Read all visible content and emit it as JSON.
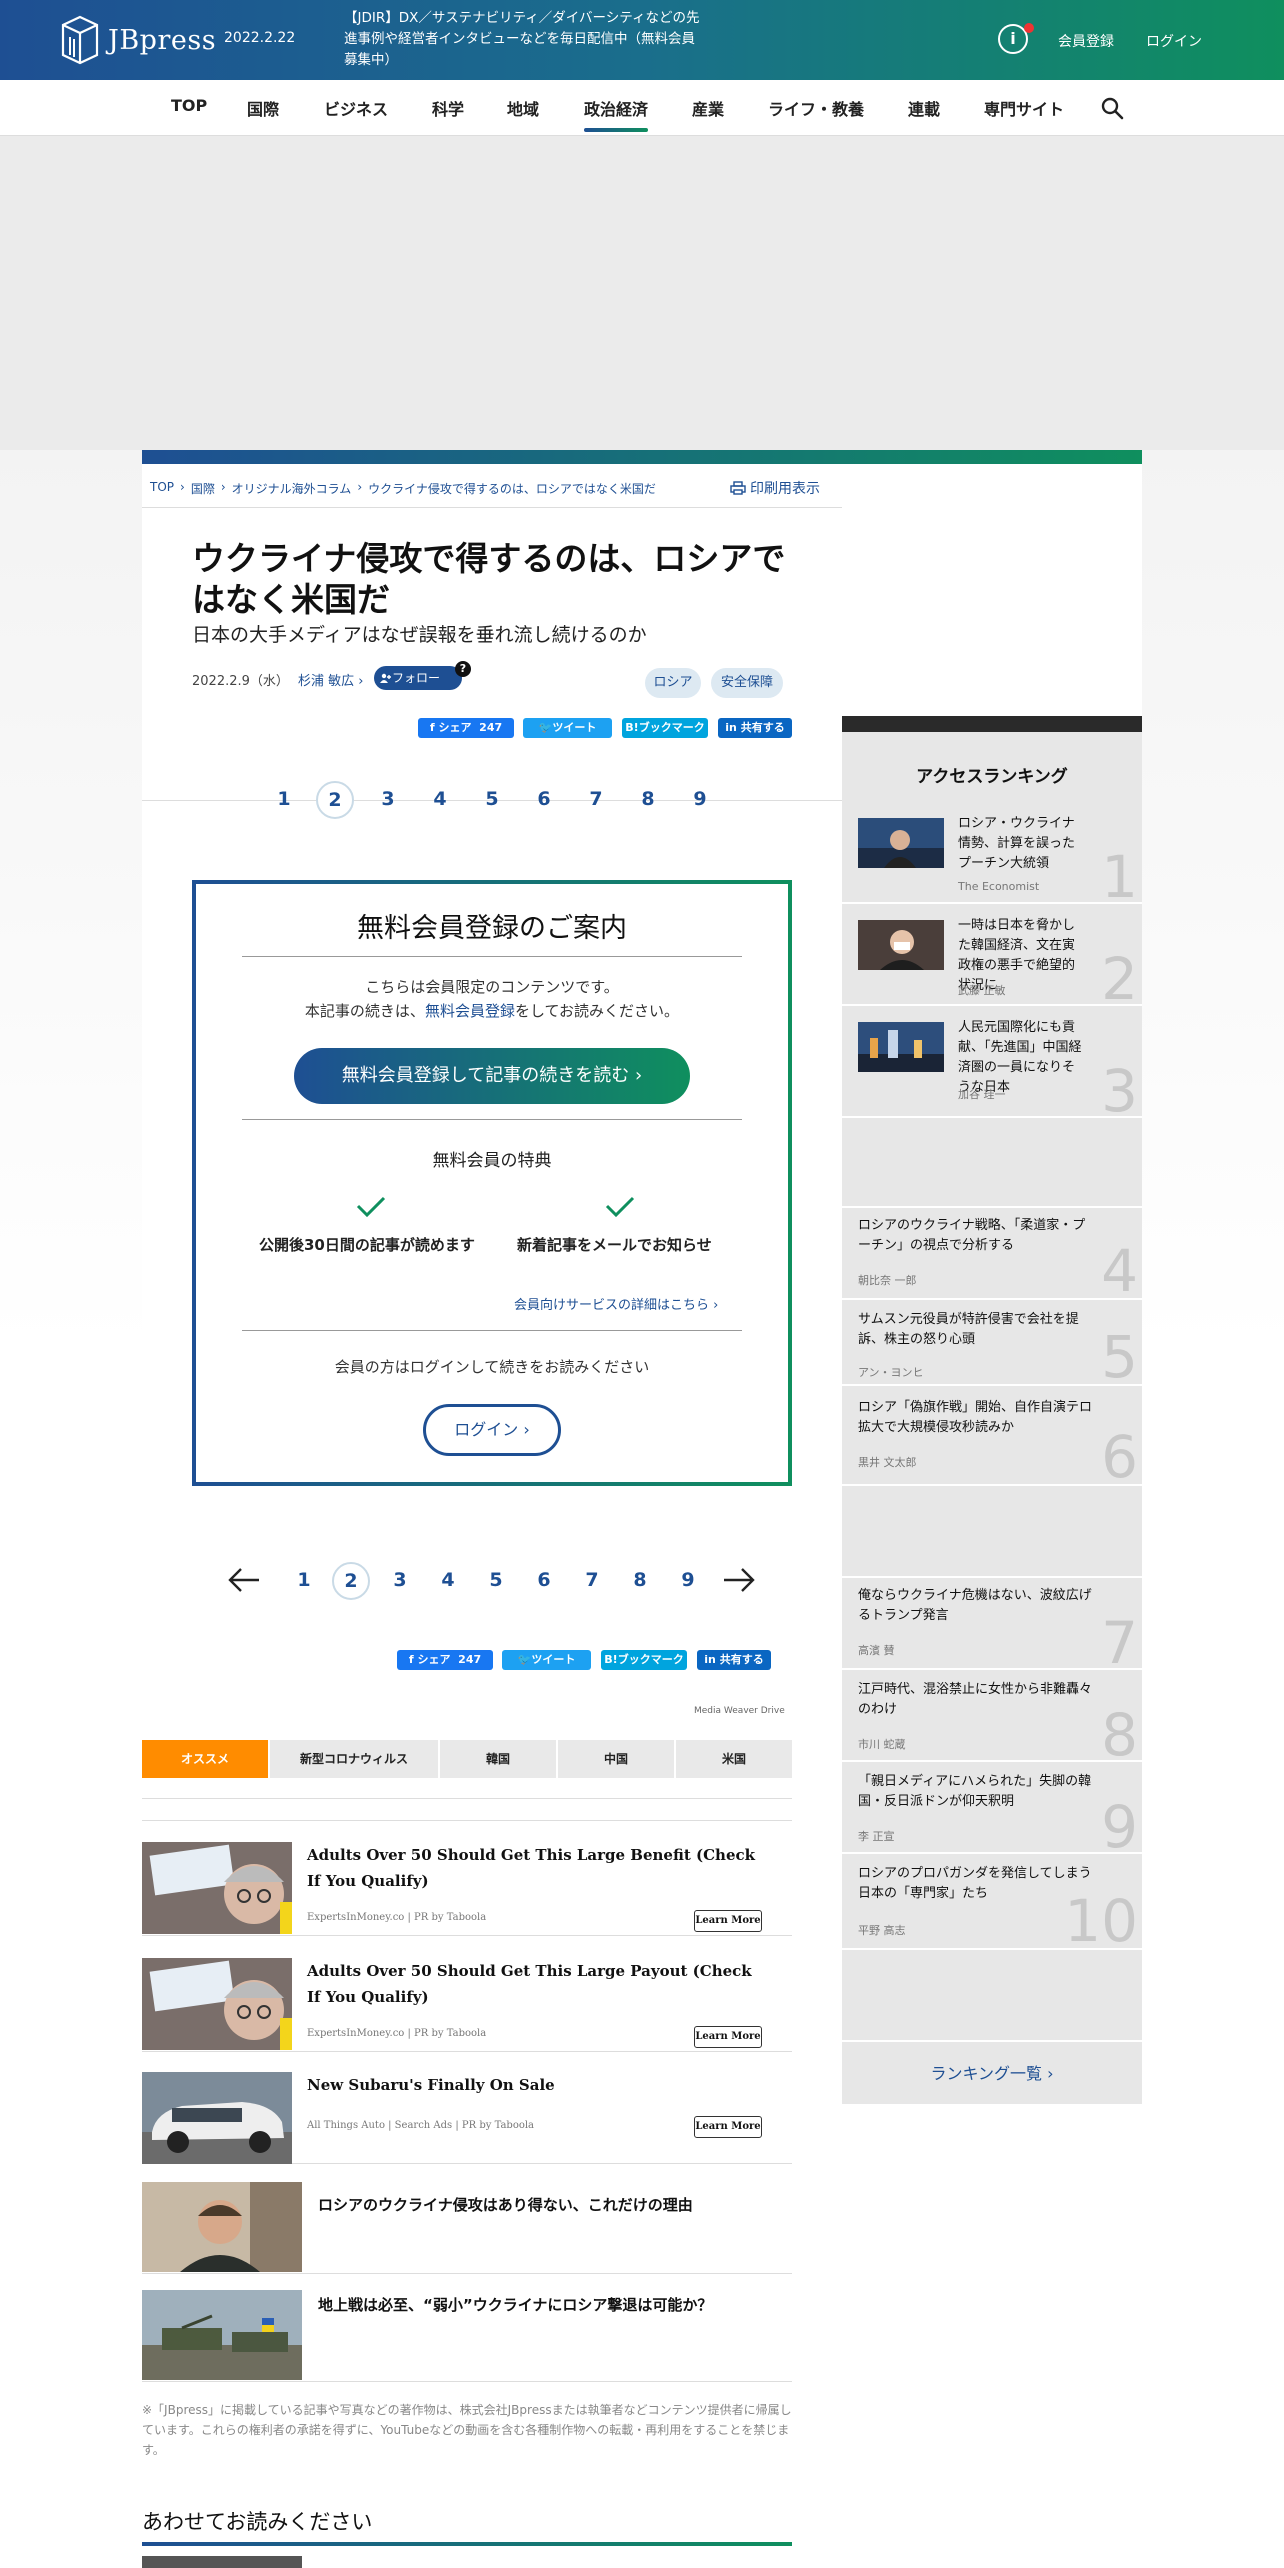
{
  "header": {
    "logo_text": "JBpress",
    "date": "2022.2.22",
    "news": "【JDIR】DX／サステナビリティ／ダイバーシティなどの先進事例や経営者インタビューなどを毎日配信中（無料会員募集中）",
    "info_icon": "i",
    "register": "会員登録",
    "login": "ログイン"
  },
  "nav": {
    "items": [
      "TOP",
      "国際",
      "ビジネス",
      "科学",
      "地域",
      "政治経済",
      "産業",
      "ライフ・教養",
      "連載",
      "専門サイト"
    ],
    "active": "政治経済"
  },
  "breadcrumb": [
    "TOP",
    "国際",
    "オリジナル海外コラム",
    "ウクライナ侵攻で得するのは、ロシアではなく米国だ"
  ],
  "print_label": "印刷用表示",
  "article": {
    "title": "ウクライナ侵攻で得するのは、ロシアではなく米国だ",
    "subtitle": "日本の大手メディアはなぜ誤報を垂れ流し続けるのか",
    "date": "2022.2.9（水）",
    "author": "杉浦 敏広",
    "follow": "フォロー",
    "follow_help": "?",
    "tags": [
      "ロシア",
      "安全保障"
    ]
  },
  "share": {
    "facebook": "シェア",
    "facebook_count": "247",
    "tweet": "ツイート",
    "bookmark": "ブックマーク",
    "linkedin": "共有する"
  },
  "pages": [
    "1",
    "2",
    "3",
    "4",
    "5",
    "6",
    "7",
    "8",
    "9"
  ],
  "current_page": "2",
  "paywall": {
    "title": "無料会員登録のご案内",
    "text1": "こちらは会員限定のコンテンツです。",
    "text2_pre": "本記事の続きは、",
    "text2_link": "無料会員登録",
    "text2_post": "をしてお読みください。",
    "button": "無料会員登録して記事の続きを読む ›",
    "benefits_title": "無料会員の特典",
    "benefit1": "公開後30日間の記事が読めます",
    "benefit2": "新着記事をメールでお知らせ",
    "detail_link": "会員向けサービスの詳細はこちら ›",
    "login_text": "会員の方はログインして続きをお読みください",
    "login_button": "ログイン ›"
  },
  "media_weaver": "Media Weaver Drive",
  "tabs": [
    "オススメ",
    "新型コロナウィルス",
    "韓国",
    "中国",
    "米国"
  ],
  "recommended": [
    {
      "title": "Adults Over 50 Should Get This Large Benefit (Check If You Qualify)",
      "source": "ExpertsInMoney.co | PR by Taboola",
      "button": "Learn More"
    },
    {
      "title": "Adults Over 50 Should Get This Large Payout (Check If You Qualify)",
      "source": "ExpertsInMoney.co | PR by Taboola",
      "button": "Learn More"
    },
    {
      "title": "New Subaru's Finally On Sale",
      "source": "All Things Auto | Search Ads | PR by Taboola",
      "button": "Learn More"
    },
    {
      "title": "ロシアのウクライナ侵攻はあり得ない、これだけの理由"
    },
    {
      "title": "地上戦は必至、“弱小”ウクライナにロシア撃退は可能か？"
    }
  ],
  "copyright": "※「JBpress」に掲載している記事や写真などの著作物は、株式会社JBpressまたは執筆者などコンテンツ提供者に帰属しています。これらの権利者の承諾を得ずに、YouTubeなどの動画を含む各種制作物への転載・再利用をすることを禁じます。",
  "also_read": "あわせてお読みください",
  "ranking": {
    "title": "アクセスランキング",
    "items": [
      {
        "rank": "1",
        "title": "ロシア・ウクライナ情勢、計算を誤ったプーチン大統領",
        "author": "The Economist"
      },
      {
        "rank": "2",
        "title": "一時は日本を脅かした韓国経済、文在寅政権の悪手で絶望的状況に",
        "author": "武藤 正敏"
      },
      {
        "rank": "3",
        "title": "人民元国際化にも貢献、「先進国」中国経済圏の一員になりそうな日本",
        "author": "加谷 珪一"
      },
      {
        "rank": "4",
        "title": "ロシアのウクライナ戦略、「柔道家・プーチン」の視点で分析する",
        "author": "朝比奈 一郎"
      },
      {
        "rank": "5",
        "title": "サムスン元役員が特許侵害で会社を提訴、株主の怒り心頭",
        "author": "アン・ヨンヒ"
      },
      {
        "rank": "6",
        "title": "ロシア「偽旗作戦」開始、自作自演テロ拡大で大規模侵攻秒読みか",
        "author": "黒井 文太郎"
      },
      {
        "rank": "7",
        "title": "俺ならウクライナ危機はない、波紋広げるトランプ発言",
        "author": "高濱 賛"
      },
      {
        "rank": "8",
        "title": "江戸時代、混浴禁止に女性から非難轟々のわけ",
        "author": "市川 蛇蔵"
      },
      {
        "rank": "9",
        "title": "「親日メディアにハメられた」失脚の韓国・反日派ドンが仰天釈明",
        "author": "李 正宣"
      },
      {
        "rank": "10",
        "title": "ロシアのプロパガンダを発信してしまう日本の「専門家」たち",
        "author": "平野 高志"
      }
    ],
    "more": "ランキング一覧 ›"
  },
  "colors": {
    "brand_blue": "#1e4f93",
    "brand_green": "#0f8f5e",
    "tab_active": "#ff8c00"
  }
}
